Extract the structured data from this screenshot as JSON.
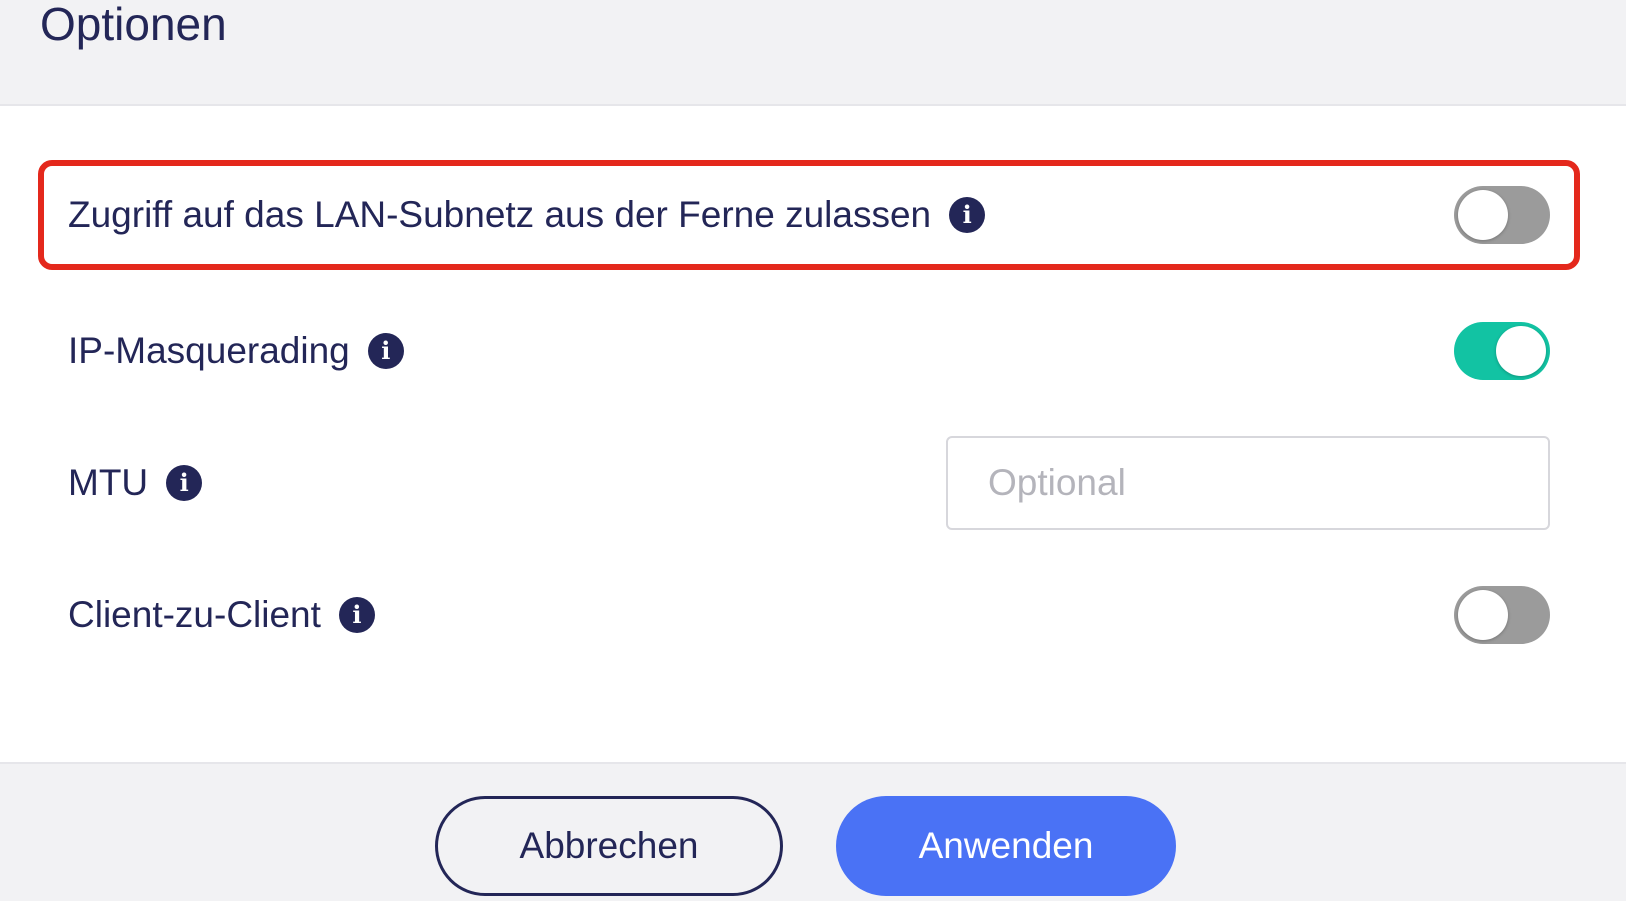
{
  "dialog": {
    "title": "Optionen"
  },
  "options": [
    {
      "label": "Zugriff auf das LAN-Subnetz aus der Ferne zulassen",
      "control": "toggle",
      "enabled": false,
      "highlighted": true,
      "highlight_color": "#e4281c"
    },
    {
      "label": "IP-Masquerading",
      "control": "toggle",
      "enabled": true
    },
    {
      "label": "MTU",
      "control": "input",
      "value": "",
      "placeholder": "Optional"
    },
    {
      "label": "Client-zu-Client",
      "control": "toggle",
      "enabled": false
    }
  ],
  "icons": {
    "info": "info-icon",
    "info_glyph": "i"
  },
  "footer": {
    "cancel_label": "Abbrechen",
    "apply_label": "Anwenden"
  },
  "colors": {
    "text": "#232657",
    "toggle_on": "#12c3a3",
    "toggle_off": "#9b9b9b",
    "primary_button": "#4a72f5"
  }
}
